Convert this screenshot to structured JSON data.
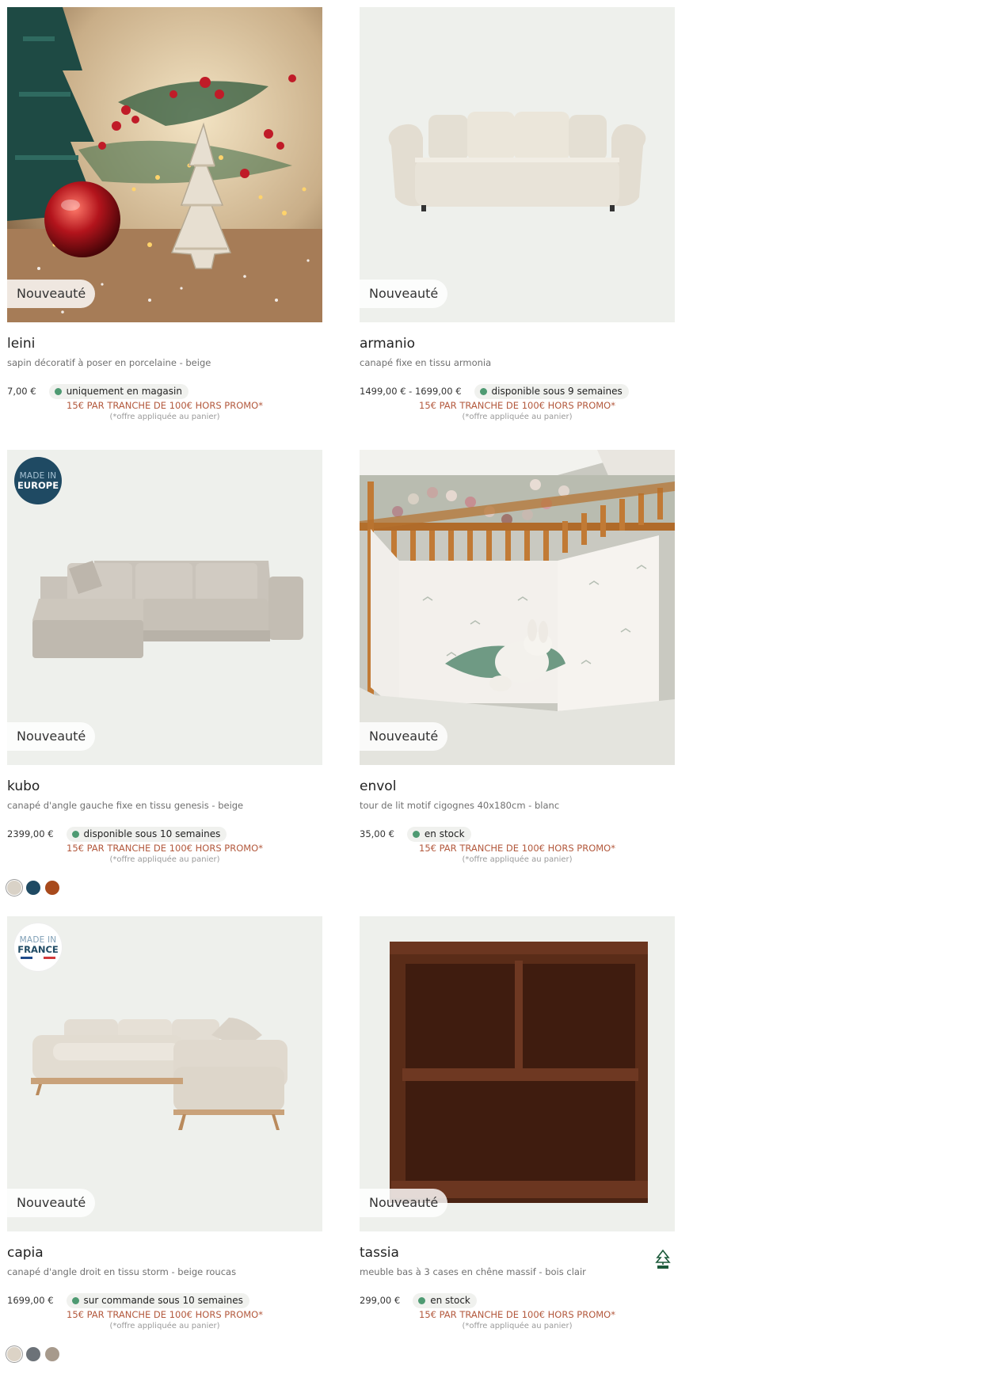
{
  "products": [
    {
      "badge": "Nouveauté",
      "name": "leini",
      "desc": "sapin décoratif à poser en porcelaine - beige",
      "price": "7,00 €",
      "stock": "uniquement en magasin",
      "promo": "15€ PAR TRANCHE DE 100€ HORS PROMO*",
      "offer": "(*offre appliquée au panier)"
    },
    {
      "badge": "Nouveauté",
      "name": "armanio",
      "desc": "canapé fixe en tissu armonia",
      "price": "1499,00 € - 1699,00 €",
      "stock": "disponible sous 9 semaines",
      "promo": "15€ PAR TRANCHE DE 100€ HORS PROMO*",
      "offer": "(*offre appliquée au panier)"
    },
    {
      "badge": "Nouveauté",
      "made_in": {
        "line1": "MADE IN",
        "line2": "EUROPE"
      },
      "name": "kubo",
      "desc": "canapé d'angle gauche fixe en tissu genesis - beige",
      "price": "2399,00 €",
      "stock": "disponible sous 10 semaines",
      "promo": "15€ PAR TRANCHE DE 100€ HORS PROMO*",
      "offer": "(*offre appliquée au panier)",
      "swatches": [
        "#d9d2c7",
        "#1f4a63",
        "#a84a1c"
      ]
    },
    {
      "badge": "Nouveauté",
      "name": "envol",
      "desc": "tour de lit motif cigognes 40x180cm - blanc",
      "price": "35,00 €",
      "stock": "en stock",
      "promo": "15€ PAR TRANCHE DE 100€ HORS PROMO*",
      "offer": "(*offre appliquée au panier)"
    },
    {
      "badge": "Nouveauté",
      "made_in": {
        "line1": "MADE IN",
        "line2": "FRANCE"
      },
      "name": "capia",
      "desc": "canapé d'angle droit en tissu storm - beige roucas",
      "price": "1699,00 €",
      "stock": "sur commande sous 10 semaines",
      "promo": "15€ PAR TRANCHE DE 100€ HORS PROMO*",
      "offer": "(*offre appliquée au panier)",
      "swatches": [
        "#dcd3c6",
        "#6c7278",
        "#a79a8c"
      ]
    },
    {
      "badge": "Nouveauté",
      "name": "tassia",
      "desc": "meuble bas à 3 cases en chêne massif - bois clair",
      "price": "299,00 €",
      "stock": "en stock",
      "promo": "15€ PAR TRANCHE DE 100€ HORS PROMO*",
      "offer": "(*offre appliquée au panier)",
      "certification_icon": "fsc-tree-icon"
    }
  ],
  "colors": {
    "promo": "#b3593d",
    "stock_dot": "#4e9a72",
    "image_bg": "#eef0ec"
  }
}
